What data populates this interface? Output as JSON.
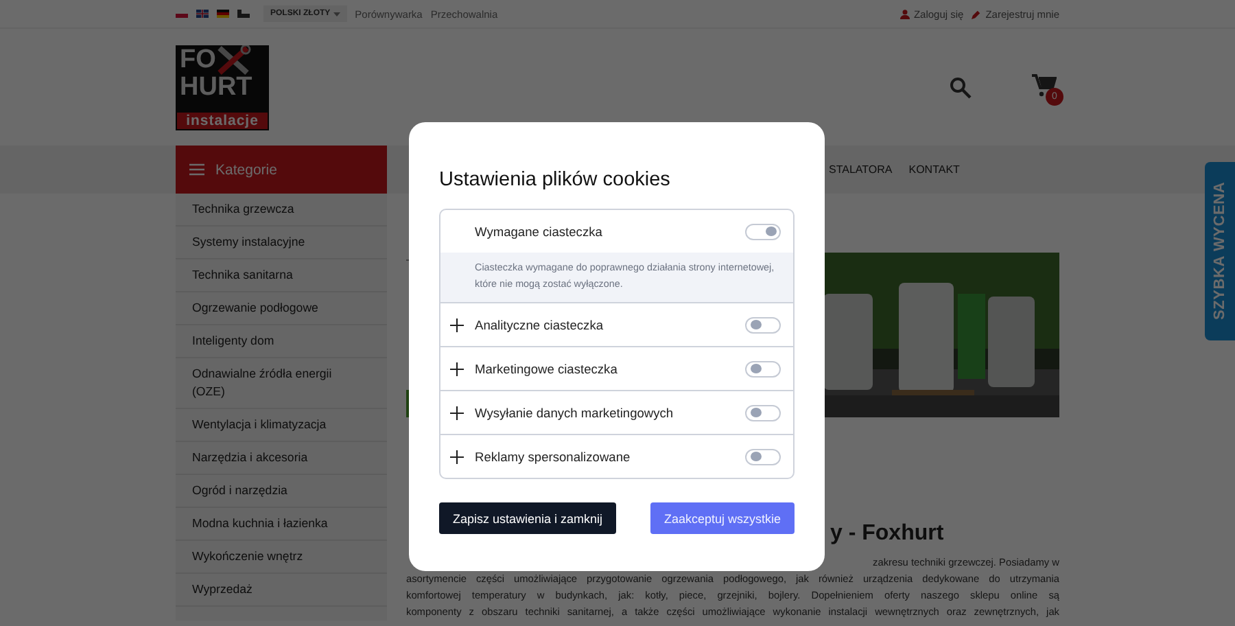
{
  "top_bar": {
    "currency": "POLSKI ZŁOTY",
    "links": [
      "Porównywarka",
      "Przechowalnia"
    ],
    "account": [
      {
        "kind": "login",
        "label": "Zaloguj się"
      },
      {
        "kind": "register",
        "label": "Zarejestruj mnie"
      }
    ]
  },
  "header": {
    "logo": {
      "top": "FO",
      "middle": "HURT",
      "bottom": "instalacje"
    },
    "cart_count": "0"
  },
  "categories": {
    "title": "Kategorie",
    "items": [
      "Technika grzewcza",
      "Systemy instalacyjne",
      "Technika sanitarna",
      "Ogrzewanie podłogowe",
      "Inteligenty dom",
      "Odnawialne źródła energii (OZE)",
      "Wentylacja i klimatyzacja",
      "Narzędzia i akcesoria",
      "Ogród i narzędzia",
      "Modna kuchnia i łazienka",
      "Wykończenie wnętrz",
      "Wyprzedaż"
    ]
  },
  "nav": [
    "STALATORA",
    "KONTAKT"
  ],
  "banner": {
    "kind": "picture"
  },
  "heading": "y - Foxhurt",
  "paragraph_lines": [
    "zakresu techniki grzewczej. Posiadamy w",
    "asortymencie części umożliwiające przygotowanie ogrzewania podłogowego, jak również urządzenia dedykowane do utrzymania",
    "komfortowej temperatury w budynkach, jak: kotły, piece, grzejniki, bojlery. Dopełnieniem oferty naszego sklepu online są",
    "komponenty z obszaru techniki sanitarnej, a także części umożliwiające wykonanie instalacji wewnętrznych oraz zewnętrznych, jak"
  ],
  "quick_quote": "SZYBKA WYCENA",
  "cookie_modal": {
    "title": "Ustawienia plików cookies",
    "groups": [
      {
        "label": "Wymagane ciasteczka",
        "on": true,
        "expanded": true,
        "description": "Ciasteczka wymagane do poprawnego działania strony internetowej, które nie mogą zostać wyłączone."
      },
      {
        "label": "Analityczne ciasteczka",
        "on": false,
        "expanded": false
      },
      {
        "label": "Marketingowe ciasteczka",
        "on": false,
        "expanded": false
      },
      {
        "label": "Wysyłanie danych marketingowych",
        "on": false,
        "expanded": false
      },
      {
        "label": "Reklamy spersonalizowane",
        "on": false,
        "expanded": false
      }
    ],
    "buttons": [
      {
        "label": "Zapisz ustawienia i zamknij",
        "kind": "secondary"
      },
      {
        "label": "Zaakceptuj wszystkie",
        "kind": "primary"
      }
    ]
  }
}
